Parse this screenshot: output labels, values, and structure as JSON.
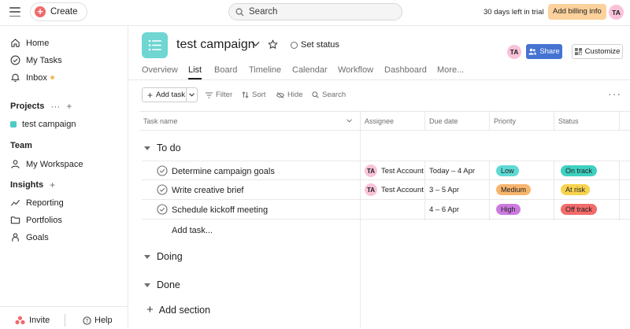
{
  "topbar": {
    "create_label": "Create",
    "search_placeholder": "Search",
    "trial_text": "30 days left in trial",
    "billing_label": "Add billing info",
    "user_initials": "TA"
  },
  "sidebar": {
    "home": "Home",
    "my_tasks": "My Tasks",
    "inbox": "Inbox",
    "projects_heading": "Projects",
    "project_name": "test campaign",
    "team_heading": "Team",
    "workspace": "My Workspace",
    "insights_heading": "Insights",
    "reporting": "Reporting",
    "portfolios": "Portfolios",
    "goals": "Goals",
    "invite": "Invite",
    "help": "Help"
  },
  "project": {
    "title": "test campaign",
    "set_status": "Set status",
    "avatar": "TA",
    "share": "Share",
    "customize": "Customize"
  },
  "tabs": [
    "Overview",
    "List",
    "Board",
    "Timeline",
    "Calendar",
    "Workflow",
    "Dashboard",
    "More..."
  ],
  "toolbar": {
    "add_task": "Add task",
    "filter": "Filter",
    "sort": "Sort",
    "hide": "Hide",
    "search": "Search"
  },
  "table": {
    "columns": [
      "Task name",
      "Assignee",
      "Due date",
      "Priority",
      "Status"
    ],
    "sections": [
      "To do",
      "Doing",
      "Done"
    ],
    "tasks": [
      {
        "name": "Determine campaign goals",
        "assignee_initials": "TA",
        "assignee": "Test Account",
        "due": "Today – 4 Apr",
        "priority": "Low",
        "status": "On track"
      },
      {
        "name": "Write creative brief",
        "assignee_initials": "TA",
        "assignee": "Test Account",
        "due": "3 – 5 Apr",
        "priority": "Medium",
        "status": "At risk"
      },
      {
        "name": "Schedule kickoff meeting",
        "assignee_initials": "",
        "assignee": "",
        "due": "4 – 6 Apr",
        "priority": "High",
        "status": "Off track"
      }
    ],
    "add_task_link": "Add task...",
    "add_section": "Add section"
  },
  "colors": {
    "create_plus": "#f06a6a",
    "billing_bg": "#fcd19c",
    "share_bg": "#4573d2",
    "project_icon_bg": "#6fd6d2",
    "priority_low": "#5fd9d4",
    "priority_medium": "#f8b56d",
    "priority_high": "#cd7be0",
    "status_on_track": "#3fd0c0",
    "status_at_risk": "#f8d34d",
    "status_off_track": "#f36b6b"
  }
}
